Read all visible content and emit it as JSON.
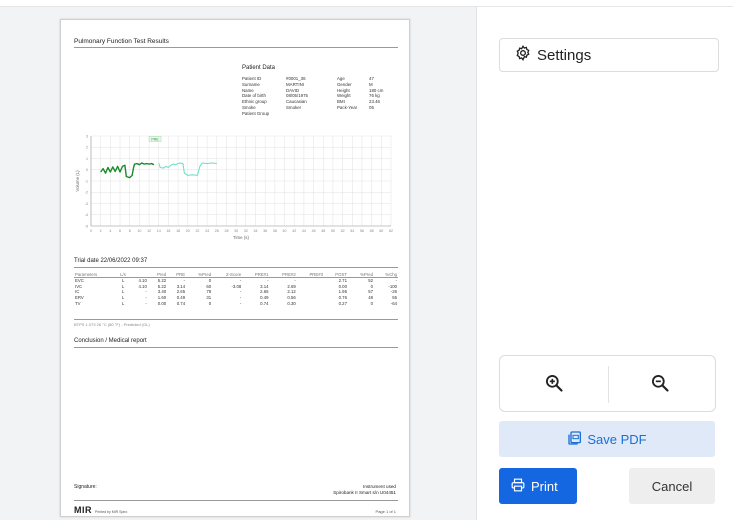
{
  "report": {
    "title": "Pulmonary Function Test Results",
    "patient_data_title": "Patient Data",
    "patient_left": [
      {
        "label": "Patient ID",
        "value": "#0001_36"
      },
      {
        "label": "Surname",
        "value": "MARTINI"
      },
      {
        "label": "Name",
        "value": "DAVID"
      },
      {
        "label": "Date of birth",
        "value": "08/05/1975"
      },
      {
        "label": "Ethnic group",
        "value": "Caucasian"
      },
      {
        "label": "Smoke",
        "value": "Smoker"
      },
      {
        "label": "Patient Group",
        "value": ""
      }
    ],
    "patient_right": [
      {
        "label": "Age",
        "value": "47"
      },
      {
        "label": "Gender",
        "value": "M"
      },
      {
        "label": "Height",
        "value": "180 cm"
      },
      {
        "label": "Weight",
        "value": "76 kg"
      },
      {
        "label": "BMI",
        "value": "23.46"
      },
      {
        "label": "Pack-Year",
        "value": "05"
      }
    ],
    "trial_title": "Trial date 22/06/2022 09:37",
    "table_headers": [
      "Parameters",
      "L/s",
      "Pred",
      "PRE",
      "%Pred",
      "Z-Score",
      "PRE#1",
      "PRE#2",
      "PRE#3",
      "POST",
      "%Pred",
      "%Chg"
    ],
    "table_rows": [
      [
        "EVC",
        "L",
        "4.10",
        "5.22",
        "-",
        "0",
        "-",
        "-",
        "-",
        "",
        "2.71",
        "52",
        "-"
      ],
      [
        "IVC",
        "L",
        "4.10",
        "5.22",
        "3.14",
        "60",
        "-3.08",
        "3.14",
        "2.69",
        "",
        "0.00",
        "0",
        "-100"
      ],
      [
        "IC",
        "L",
        "-",
        "3.40",
        "2.65",
        "78",
        "-",
        "2.65",
        "2.12",
        "",
        "1.95",
        "57",
        "-26"
      ],
      [
        "ERV",
        "L",
        "-",
        "1.60",
        "0.49",
        "31",
        "-",
        "0.49",
        "0.56",
        "",
        "0.76",
        "48",
        "55"
      ],
      [
        "TV",
        "L",
        "-",
        "0.00",
        "0.74",
        "0",
        "-",
        "0.74",
        "0.30",
        "",
        "0.27",
        "0",
        "-64"
      ]
    ],
    "btps_note": "BTPS 1.073 26 °C (80 °F) - Predicted (GL)",
    "conclusion_title": "Conclusion / Medical report",
    "signature_label": "Signature:",
    "instrument_line1": "Instrument used",
    "instrument_line2": "Spirobank II Smart s/n U04451",
    "logo_text": "MIR",
    "printed_by": "Printed by MIR Spiro",
    "page_label": "Page 1 of 1"
  },
  "chart_data": {
    "type": "line",
    "xlabel": "Time (s)",
    "ylabel": "Volume (L)",
    "xlim": [
      0,
      62
    ],
    "ylim": [
      -5,
      3
    ],
    "x_ticks": [
      0,
      2,
      4,
      6,
      8,
      10,
      12,
      14,
      16,
      18,
      20,
      22,
      24,
      26,
      28,
      30,
      32,
      34,
      36,
      38,
      40,
      42,
      44,
      46,
      48,
      50,
      52,
      54,
      56,
      58,
      60,
      62
    ],
    "y_ticks": [
      3,
      2,
      1,
      0,
      -1,
      -2,
      -3,
      -4,
      -5
    ],
    "grid": true,
    "legend_label": "PRE",
    "series": [
      {
        "name": "",
        "color": "#1a8a2a",
        "points": [
          [
            2,
            -0.2
          ],
          [
            2.5,
            0.1
          ],
          [
            3,
            -0.3
          ],
          [
            3.5,
            0.2
          ],
          [
            4,
            -0.2
          ],
          [
            4.5,
            0.25
          ],
          [
            5,
            -0.15
          ],
          [
            5.5,
            0.3
          ],
          [
            6,
            -0.2
          ],
          [
            6.5,
            0.3
          ],
          [
            7,
            0.4
          ],
          [
            7.3,
            -0.6
          ],
          [
            8,
            -0.7
          ],
          [
            8.5,
            -0.5
          ],
          [
            8.8,
            0.2
          ],
          [
            9,
            0.5
          ],
          [
            9.5,
            0.55
          ],
          [
            10,
            0.45
          ],
          [
            10.5,
            0.6
          ],
          [
            11,
            0.5
          ],
          [
            11.5,
            0.55
          ],
          [
            12,
            0.5
          ],
          [
            12.5,
            0.55
          ],
          [
            13,
            0.45
          ]
        ]
      },
      {
        "name": "",
        "color": "#6fe0c8",
        "points": [
          [
            14,
            0.6
          ],
          [
            14.3,
            0.2
          ],
          [
            15,
            0.15
          ],
          [
            15.5,
            0.3
          ],
          [
            16,
            0.2
          ],
          [
            16.5,
            0.4
          ],
          [
            17,
            0.5
          ],
          [
            17.5,
            0.45
          ],
          [
            18,
            0.55
          ],
          [
            18.5,
            0.6
          ],
          [
            19,
            0.55
          ],
          [
            19.3,
            -0.3
          ],
          [
            20,
            -0.5
          ],
          [
            21,
            -0.45
          ],
          [
            22,
            -0.5
          ],
          [
            22.5,
            0.3
          ],
          [
            23,
            0.6
          ],
          [
            24,
            0.55
          ],
          [
            25,
            0.6
          ],
          [
            26,
            0.55
          ]
        ]
      }
    ]
  },
  "panel": {
    "settings_label": "Settings",
    "save_pdf_label": "Save PDF",
    "print_label": "Print",
    "cancel_label": "Cancel"
  },
  "icons": {
    "settings": "gear-icon",
    "zoom_in": "zoom-in-icon",
    "zoom_out": "zoom-out-icon",
    "save_pdf": "pdf-file-icon",
    "print": "printer-icon"
  },
  "colors": {
    "primary": "#1467e0",
    "save_bg": "#dfe9f8",
    "pre_series": "#1a8a2a",
    "second_series": "#6fe0c8"
  }
}
